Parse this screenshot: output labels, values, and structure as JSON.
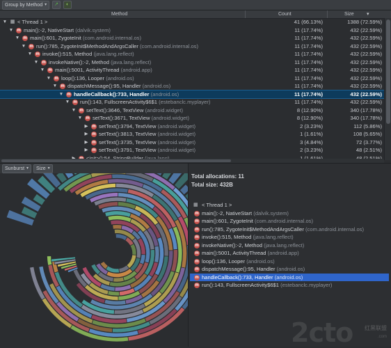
{
  "toolbar": {
    "group_by_label": "Group by Method",
    "export_icon": "export-icon",
    "filter_icon": "filter-icon"
  },
  "columns": {
    "method": "Method",
    "count": "Count",
    "size": "Size"
  },
  "tree": {
    "rows": [
      {
        "depth": 0,
        "expand": "▼",
        "kind": "thread",
        "name": "< Thread 1 >",
        "pkg": "",
        "count": "41 (66.13%)",
        "size": "1388 (72.59%)",
        "selected": false
      },
      {
        "depth": 1,
        "expand": "▼",
        "kind": "method",
        "name": "main():-2, NativeStart",
        "pkg": "(dalvik.system)",
        "count": "11 (17.74%)",
        "size": "432 (22.59%)",
        "selected": false
      },
      {
        "depth": 2,
        "expand": "▼",
        "kind": "method",
        "name": "main():601, ZygoteInit",
        "pkg": "(com.android.internal.os)",
        "count": "11 (17.74%)",
        "size": "432 (22.59%)",
        "selected": false
      },
      {
        "depth": 3,
        "expand": "▼",
        "kind": "method",
        "name": "run():785, ZygoteInit$MethodAndArgsCaller",
        "pkg": "(com.android.internal.os)",
        "count": "11 (17.74%)",
        "size": "432 (22.59%)",
        "selected": false
      },
      {
        "depth": 4,
        "expand": "▼",
        "kind": "method",
        "name": "invoke():515, Method",
        "pkg": "(java.lang.reflect)",
        "count": "11 (17.74%)",
        "size": "432 (22.59%)",
        "selected": false
      },
      {
        "depth": 5,
        "expand": "▼",
        "kind": "method",
        "name": "invokeNative():-2, Method",
        "pkg": "(java.lang.reflect)",
        "count": "11 (17.74%)",
        "size": "432 (22.59%)",
        "selected": false
      },
      {
        "depth": 6,
        "expand": "▼",
        "kind": "method",
        "name": "main():5001, ActivityThread",
        "pkg": "(android.app)",
        "count": "11 (17.74%)",
        "size": "432 (22.59%)",
        "selected": false
      },
      {
        "depth": 7,
        "expand": "▼",
        "kind": "method",
        "name": "loop():136, Looper",
        "pkg": "(android.os)",
        "count": "11 (17.74%)",
        "size": "432 (22.59%)",
        "selected": false
      },
      {
        "depth": 8,
        "expand": "▼",
        "kind": "method",
        "name": "dispatchMessage():95, Handler",
        "pkg": "(android.os)",
        "count": "11 (17.74%)",
        "size": "432 (22.59%)",
        "selected": false
      },
      {
        "depth": 9,
        "expand": "▼",
        "kind": "method",
        "name": "handleCallback():733, Handler",
        "pkg": "(android.os)",
        "count": "11 (17.74%)",
        "size": "432 (22.59%)",
        "selected": true
      },
      {
        "depth": 10,
        "expand": "▼",
        "kind": "method",
        "name": "run():143, FullscreenActivity$6$1",
        "pkg": "(estebanclc.myplayer)",
        "count": "11 (17.74%)",
        "size": "432 (22.59%)",
        "selected": false
      },
      {
        "depth": 11,
        "expand": "▼",
        "kind": "method",
        "name": "setText():3646, TextView",
        "pkg": "(android.widget)",
        "count": "8 (12.90%)",
        "size": "340 (17.78%)",
        "selected": false
      },
      {
        "depth": 12,
        "expand": "▼",
        "kind": "method",
        "name": "setText():3671, TextView",
        "pkg": "(android.widget)",
        "count": "8 (12.90%)",
        "size": "340 (17.78%)",
        "selected": false
      },
      {
        "depth": 13,
        "expand": "▶",
        "kind": "method",
        "name": "setText():3794, TextView",
        "pkg": "(android.widget)",
        "count": "2 (3.23%)",
        "size": "112 (5.86%)",
        "selected": false
      },
      {
        "depth": 13,
        "expand": "▶",
        "kind": "method",
        "name": "setText():3813, TextView",
        "pkg": "(android.widget)",
        "count": "1 (1.61%)",
        "size": "108 (5.65%)",
        "selected": false
      },
      {
        "depth": 13,
        "expand": "▶",
        "kind": "method",
        "name": "setText():3735, TextView",
        "pkg": "(android.widget)",
        "count": "3 (4.84%)",
        "size": "72 (3.77%)",
        "selected": false
      },
      {
        "depth": 13,
        "expand": "▶",
        "kind": "method",
        "name": "setText():3791, TextView",
        "pkg": "(android.widget)",
        "count": "2 (3.23%)",
        "size": "48 (2.51%)",
        "selected": false
      },
      {
        "depth": 11,
        "expand": "▶",
        "kind": "method",
        "name": "<init>():54, StringBuilder",
        "pkg": "(java.lang)",
        "count": "1 (1.61%)",
        "size": "48 (2.51%)",
        "selected": false
      }
    ]
  },
  "sunburst_toolbar": {
    "mode_label": "Sunburst",
    "metric_label": "Size"
  },
  "details": {
    "total_allocations": "Total allocations: 11",
    "total_size": "Total size: 432B",
    "thread_label": "< Thread 1 >",
    "stack": [
      {
        "name": "main():-2, NativeStart",
        "pkg": "(dalvik.system)",
        "selected": false
      },
      {
        "name": "main():601, ZygoteInit",
        "pkg": "(com.android.internal.os)",
        "selected": false
      },
      {
        "name": "run():785, ZygoteInit$MethodAndArgsCaller",
        "pkg": "(com.android.internal.os)",
        "selected": false
      },
      {
        "name": "invoke():515, Method",
        "pkg": "(java.lang.reflect)",
        "selected": false
      },
      {
        "name": "invokeNative():-2, Method",
        "pkg": "(java.lang.reflect)",
        "selected": false
      },
      {
        "name": "main():5001, ActivityThread",
        "pkg": "(android.app)",
        "selected": false
      },
      {
        "name": "loop():136, Looper",
        "pkg": "(android.os)",
        "selected": false
      },
      {
        "name": "dispatchMessage():95, Handler",
        "pkg": "(android.os)",
        "selected": false
      },
      {
        "name": "handleCallback():733, Handler",
        "pkg": "(android.os)",
        "selected": true
      },
      {
        "name": "run():143, FullscreenActivity$6$1",
        "pkg": "(estebanclc.myplayer)",
        "selected": false
      }
    ]
  },
  "watermark": {
    "main": "2cto",
    "side": "红黑联盟",
    "url": ".com"
  },
  "colors": {
    "selection_tree": "#0d3b5c",
    "selection_list": "#2f65ca",
    "method_icon": "#c7504a",
    "sunburst_palette": [
      "#5b8ec9",
      "#d66a6a",
      "#8fbf5b",
      "#d6c15b",
      "#8c8fa1",
      "#4aa7a3",
      "#c98a47",
      "#9c77c2",
      "#6fa0d8",
      "#b84b6b"
    ]
  }
}
